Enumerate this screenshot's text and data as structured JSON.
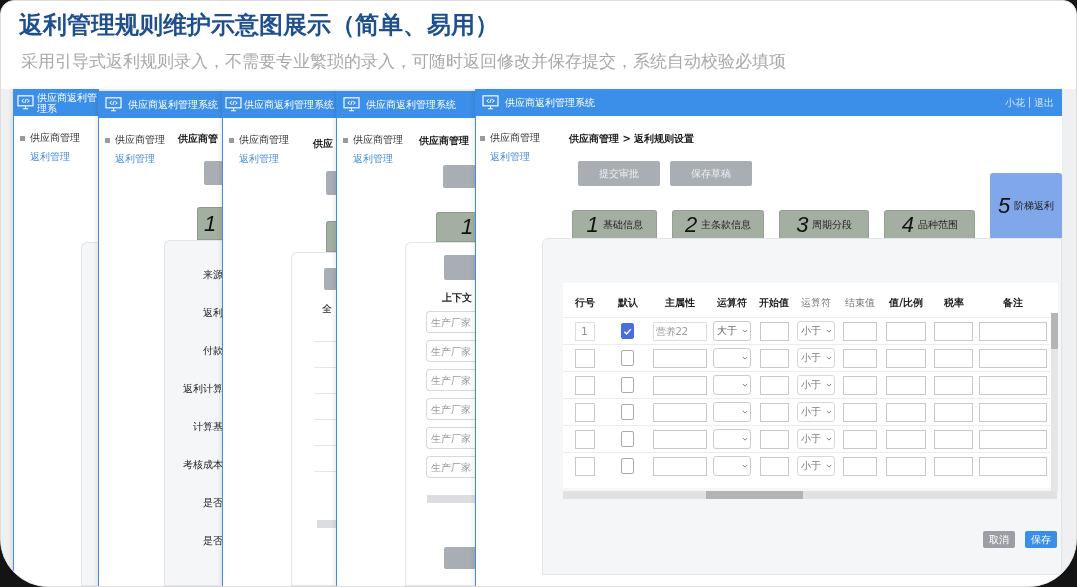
{
  "title": "返利管理规则维护示意图展示（简单、易用）",
  "subtitle": "采用引导式返利规则录入，不需要专业繁琐的录入，可随时返回修改并保存提交，系统自动校验必填项",
  "windows": [
    {
      "kind": "blank",
      "title": "供应商返利管理系",
      "sidebar": {
        "group": "供应商管理",
        "link": "返利管理"
      }
    },
    {
      "kind": "form",
      "title": "供应商返利管理系统",
      "sidebar": {
        "group": "供应商管理",
        "link": "返利管理"
      },
      "breadcrumb": "供应商管",
      "step": "1",
      "labels": [
        "来源",
        "返利",
        "付款",
        "返利计算",
        "计算基",
        "考核成本",
        "是否",
        "是否"
      ]
    },
    {
      "kind": "select",
      "title": "供应商返利管理系统",
      "sidebar": {
        "group": "供应商管理",
        "link": "返利管理"
      },
      "breadcrumb": "供应",
      "select_label": "全"
    },
    {
      "kind": "context",
      "title": "供应商返利管理系统",
      "sidebar": {
        "group": "供应商管理",
        "link": "返利管理"
      },
      "breadcrumb": "供应商管理",
      "step": "1",
      "column": "上下文",
      "placeholders": [
        "生产厂家",
        "生产厂家",
        "生产厂家",
        "生产厂家",
        "生产厂家",
        "生产厂家"
      ]
    },
    {
      "kind": "full",
      "title": "供应商返利管理系统",
      "user": "小花",
      "separator": "|",
      "logout": "退出",
      "sidebar": {
        "group": "供应商管理",
        "link": "返利管理"
      },
      "breadcrumb": "供应商管理 > 返利规则设置",
      "actions": [
        "提交审批",
        "保存草稿"
      ],
      "steps": [
        {
          "number": "1",
          "label": "基础信息",
          "selected": false
        },
        {
          "number": "2",
          "label": "主条款信息",
          "selected": false
        },
        {
          "number": "3",
          "label": "周期分段",
          "selected": false
        },
        {
          "number": "4",
          "label": "品种范围",
          "selected": false
        },
        {
          "number": "5",
          "label": "阶梯返利",
          "selected": true
        }
      ],
      "columns": [
        "行号",
        "默认",
        "主属性",
        "运算符",
        "开始值",
        "运算符",
        "结束值",
        "值/比例",
        "税率",
        "备注"
      ],
      "rows": [
        {
          "index": "1",
          "default": true,
          "attribute_placeholder": "营养22",
          "operator": "大于",
          "operator2": "小于"
        },
        {
          "default": false,
          "operator2": "小于"
        },
        {
          "default": false,
          "operator2": "小于"
        },
        {
          "default": false,
          "operator2": "小于"
        },
        {
          "default": false,
          "operator2": "小于"
        },
        {
          "default": false,
          "operator2": "小于"
        }
      ],
      "buttons": [
        {
          "label": "取消",
          "kind": "secondary"
        },
        {
          "label": "保存",
          "kind": "primary"
        }
      ]
    }
  ]
}
